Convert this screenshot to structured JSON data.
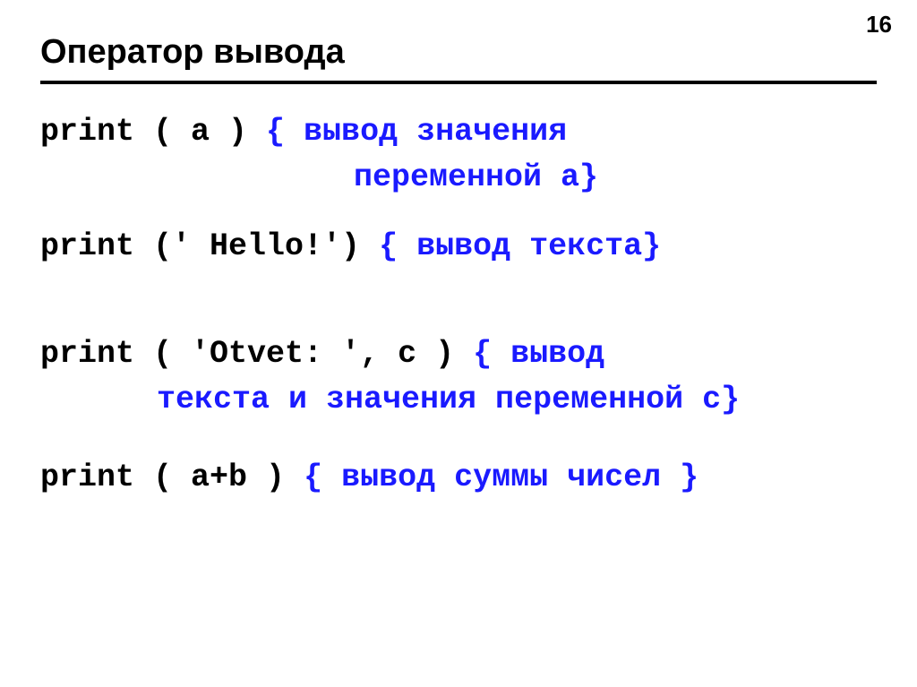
{
  "pageNumber": "16",
  "heading": "Оператор вывода",
  "lines": {
    "l1_code": "print ( a )   ",
    "l1_comment_a": "{ вывод значения",
    "l1_comment_b": "переменной a}",
    "l2_code": "print (' Hello!') ",
    "l2_comment": "{ вывод текста}",
    "l3_code": "print ( 'Otvet: ', c )   ",
    "l3_comment_a": "{ вывод",
    "l3_comment_b": "текста и значения переменной c}",
    "l4_code": "print ( a+b ) ",
    "l4_comment": "{ вывод суммы чисел }"
  }
}
